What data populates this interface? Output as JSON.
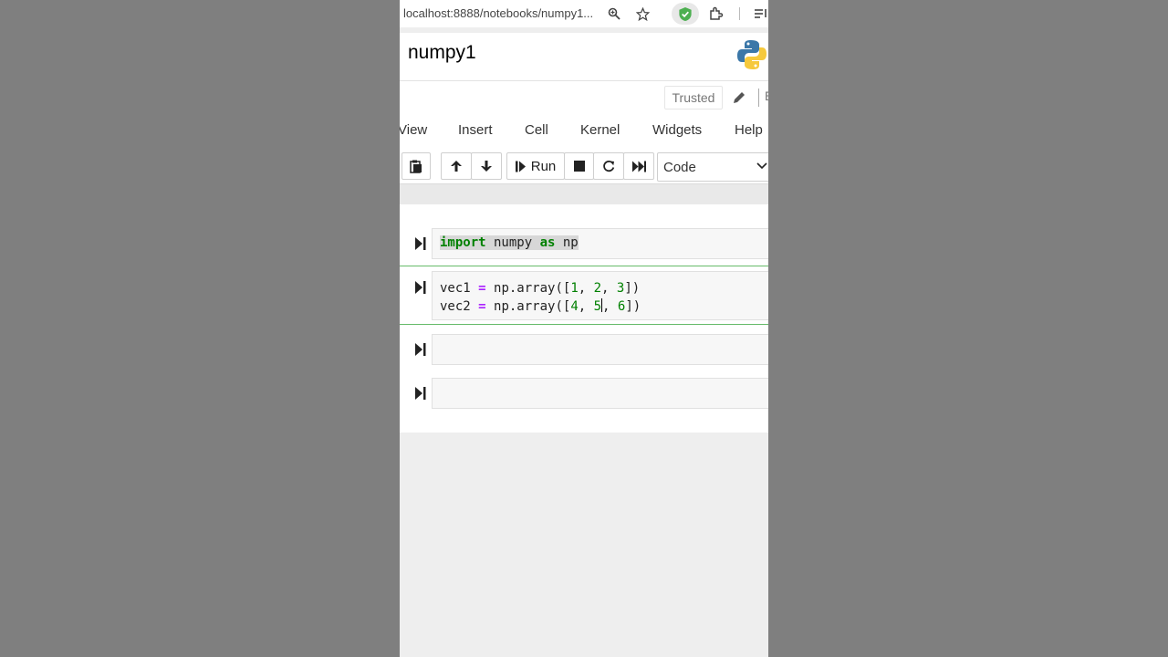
{
  "browser": {
    "url": "localhost:8888/notebooks/numpy1..."
  },
  "notebook": {
    "title": "numpy1",
    "trusted_label": "Trusted",
    "cut_char": "E"
  },
  "menu": {
    "items": [
      "View",
      "Insert",
      "Cell",
      "Kernel",
      "Widgets",
      "Help"
    ]
  },
  "toolbar": {
    "run_label": "Run",
    "cell_type": "Code"
  },
  "cells": [
    {
      "lines": [
        "import numpy as np"
      ]
    },
    {
      "lines": [
        "vec1 = np.array([1, 2, 3])",
        "vec2 = np.array([4, 5, 6])"
      ]
    },
    {
      "lines": []
    },
    {
      "lines": []
    }
  ],
  "code": {
    "c1_kw": "import",
    "c1_mid": " numpy ",
    "c1_as": "as",
    "c1_end": " np",
    "l2_a": "vec1 ",
    "l2_eq": "=",
    "l2_b": " np.array([",
    "l2_n1": "1",
    "l2_s1": ", ",
    "l2_n2": "2",
    "l2_s2": ", ",
    "l2_n3": "3",
    "l2_end": "])",
    "l3_a": "vec2 ",
    "l3_eq": "=",
    "l3_b": " np.array([",
    "l3_n1": "4",
    "l3_s1": ", ",
    "l3_n2": "5",
    "l3_s2": ", ",
    "l3_n3": "6",
    "l3_end": "])"
  },
  "colors": {
    "keyword": "#008000",
    "operator": "#aa22ff",
    "selected_border": "#66bb6a",
    "shield": "#4caf50"
  }
}
